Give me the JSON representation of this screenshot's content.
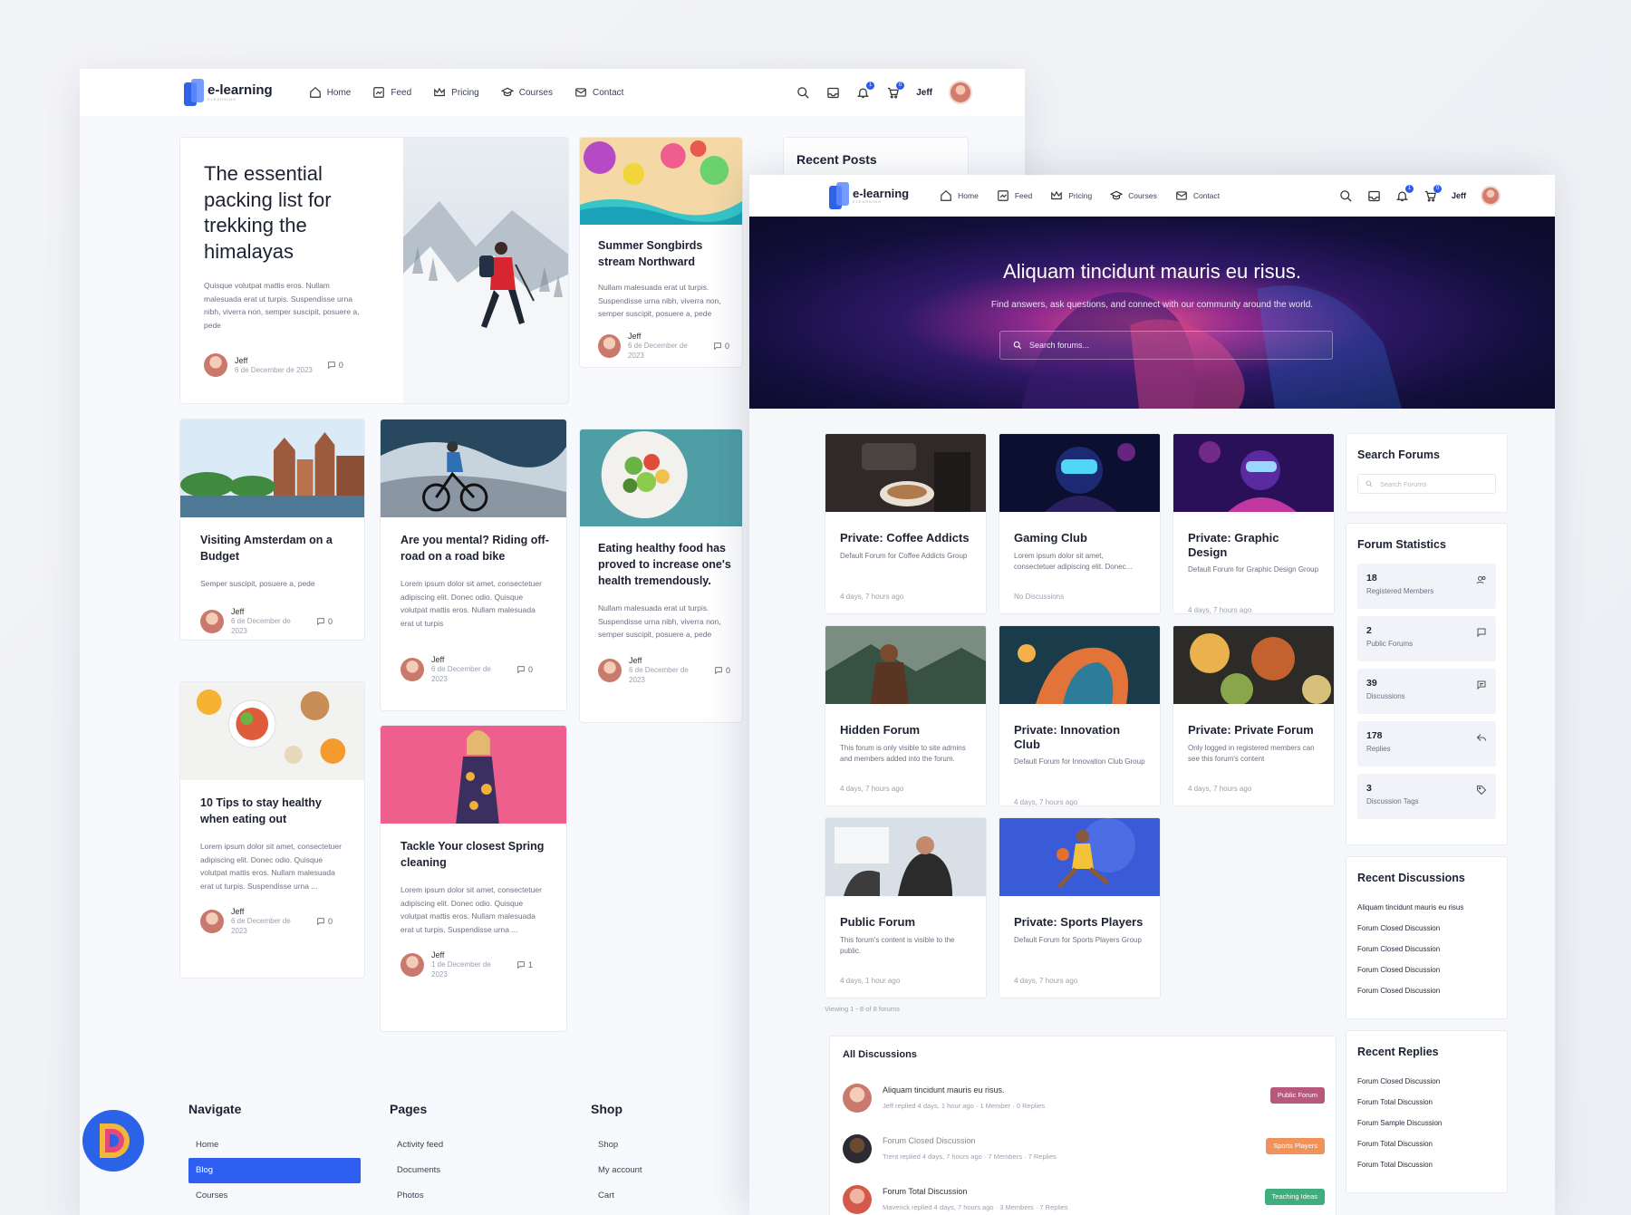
{
  "brand": {
    "name": "e-learning",
    "tagline": "ELEARNING"
  },
  "nav": {
    "items": [
      "Home",
      "Feed",
      "Pricing",
      "Courses",
      "Contact"
    ],
    "user": "Jeff",
    "notif_count": "1",
    "cart_count": "0"
  },
  "blog": {
    "featured": {
      "title": "The essential packing list for trekking the himalayas",
      "excerpt": "Quisque volutpat mattis eros. Nullam malesuada erat ut turpis. Suspendisse urna nibh, viverra non, semper suscipit, posuere a, pede",
      "author": "Jeff",
      "date": "6 de December de 2023",
      "comments": "0"
    },
    "posts": [
      {
        "title": "Summer Songbirds stream Northward",
        "excerpt": "Nullam malesuada erat ut turpis. Suspendisse urna nibh, viverra non, semper suscipit, posuere a, pede",
        "author": "Jeff",
        "date": "6 de December de 2023",
        "comments": "0"
      },
      {
        "title": "Visiting Amsterdam on a Budget",
        "excerpt": "Semper suscipit, posuere a, pede",
        "author": "Jeff",
        "date": "6 de December de 2023",
        "comments": "0"
      },
      {
        "title": "Are you mental? Riding off-road on a road bike",
        "excerpt": "Lorem ipsum dolor sit amet, consectetuer adipiscing elit. Donec odio. Quisque volutpat mattis eros. Nullam malesuada erat ut turpis",
        "author": "Jeff",
        "date": "6 de December de 2023",
        "comments": "0"
      },
      {
        "title": "Eating healthy food has proved to increase one's health tremendously.",
        "excerpt": "Nullam malesuada erat ut turpis. Suspendisse urna nibh, viverra non, semper suscipit, posuere a, pede",
        "author": "Jeff",
        "date": "6 de December de 2023",
        "comments": "0"
      },
      {
        "title": "10 Tips to stay healthy when eating out",
        "excerpt": "Lorem ipsum dolor sit amet, consectetuer adipiscing elit. Donec odio. Quisque volutpat mattis eros. Nullam malesuada erat ut turpis. Suspendisse urna ...",
        "author": "Jeff",
        "date": "6 de December de 2023",
        "comments": "0"
      },
      {
        "title": "Tackle Your closest Spring cleaning",
        "excerpt": "Lorem ipsum dolor sit amet, consectetuer adipiscing elit. Donec odio. Quisque volutpat mattis eros. Nullam malesuada erat ut turpis. Suspendisse urna ...",
        "author": "Jeff",
        "date": "1 de December de 2023",
        "comments": "1"
      }
    ],
    "recent_posts_title": "Recent Posts"
  },
  "footer": {
    "navigate": {
      "title": "Navigate",
      "items": [
        "Home",
        "Blog",
        "Courses"
      ]
    },
    "pages": {
      "title": "Pages",
      "items": [
        "Activity feed",
        "Documents",
        "Photos"
      ]
    },
    "shop": {
      "title": "Shop",
      "items": [
        "Shop",
        "My account",
        "Cart"
      ]
    }
  },
  "forum": {
    "hero_title": "Aliquam tincidunt mauris eu risus.",
    "hero_sub": "Find answers, ask questions, and connect with our community around the world.",
    "search_placeholder": "Search forums...",
    "cards": [
      {
        "title": "Private: Coffee Addicts",
        "desc": "Default Forum for Coffee Addicts Group",
        "ago": "4 days, 7 hours ago"
      },
      {
        "title": "Gaming Club",
        "desc": "Lorem ipsum dolor sit amet, consectetuer adipiscing elit. Donec...",
        "ago": "No Discussions"
      },
      {
        "title": "Private: Graphic Design",
        "desc": "Default Forum for Graphic Design Group",
        "ago": "4 days, 7 hours ago"
      },
      {
        "title": "Hidden Forum",
        "desc": "This forum is only visible to site admins and members added into the forum.",
        "ago": "4 days, 7 hours ago"
      },
      {
        "title": "Private: Innovation Club",
        "desc": "Default Forum for Innovation Club Group",
        "ago": "4 days, 7 hours ago"
      },
      {
        "title": "Private: Private Forum",
        "desc": "Only logged in registered members can see this forum's content",
        "ago": "4 days, 7 hours ago"
      },
      {
        "title": "Public Forum",
        "desc": "This forum's content is visible to the public.",
        "ago": "4 days, 1 hour ago"
      },
      {
        "title": "Private: Sports Players",
        "desc": "Default Forum for Sports Players Group",
        "ago": "4 days, 7 hours ago"
      }
    ],
    "viewing": "Viewing 1 - 8 of 8 forums",
    "all_discussions_title": "All Discussions",
    "discussions": [
      {
        "title": "Aliquam tincidunt mauris eu risus.",
        "meta": "Jeff replied 4 days, 1 hour ago · 1 Member · 0 Replies",
        "tag": "Public Forum",
        "tag_color": "#b9587d"
      },
      {
        "title": "Forum Closed Discussion",
        "meta": "Trent replied 4 days, 7 hours ago · 7 Members · 7 Replies",
        "tag": "Sports Players",
        "tag_color": "#f0925a"
      },
      {
        "title": "Forum Total Discussion",
        "meta": "Maverick replied 4 days, 7 hours ago · 3 Members · 7 Replies",
        "tag": "Teaching Ideas",
        "tag_color": "#3fae7c"
      }
    ]
  },
  "sidebar": {
    "search_title": "Search Forums",
    "search_placeholder": "Search Forums",
    "stats_title": "Forum Statistics",
    "stats": [
      {
        "n": "18",
        "label": "Registered Members"
      },
      {
        "n": "2",
        "label": "Public Forums"
      },
      {
        "n": "39",
        "label": "Discussions"
      },
      {
        "n": "178",
        "label": "Replies"
      },
      {
        "n": "3",
        "label": "Discussion Tags"
      }
    ],
    "recent_discussions_title": "Recent Discussions",
    "recent_discussions": [
      "Aliquam tincidunt mauris eu risus",
      "Forum Closed Discussion",
      "Forum Closed Discussion",
      "Forum Closed Discussion",
      "Forum Closed Discussion"
    ],
    "recent_replies_title": "Recent Replies",
    "recent_replies": [
      "Forum Closed Discussion",
      "Forum Total Discussion",
      "Forum Sample Discussion",
      "Forum Total Discussion",
      "Forum Total Discussion"
    ]
  },
  "colors": {
    "accent": "#2e5ff0",
    "text": "#1d2233",
    "muted": "#6c7183"
  }
}
